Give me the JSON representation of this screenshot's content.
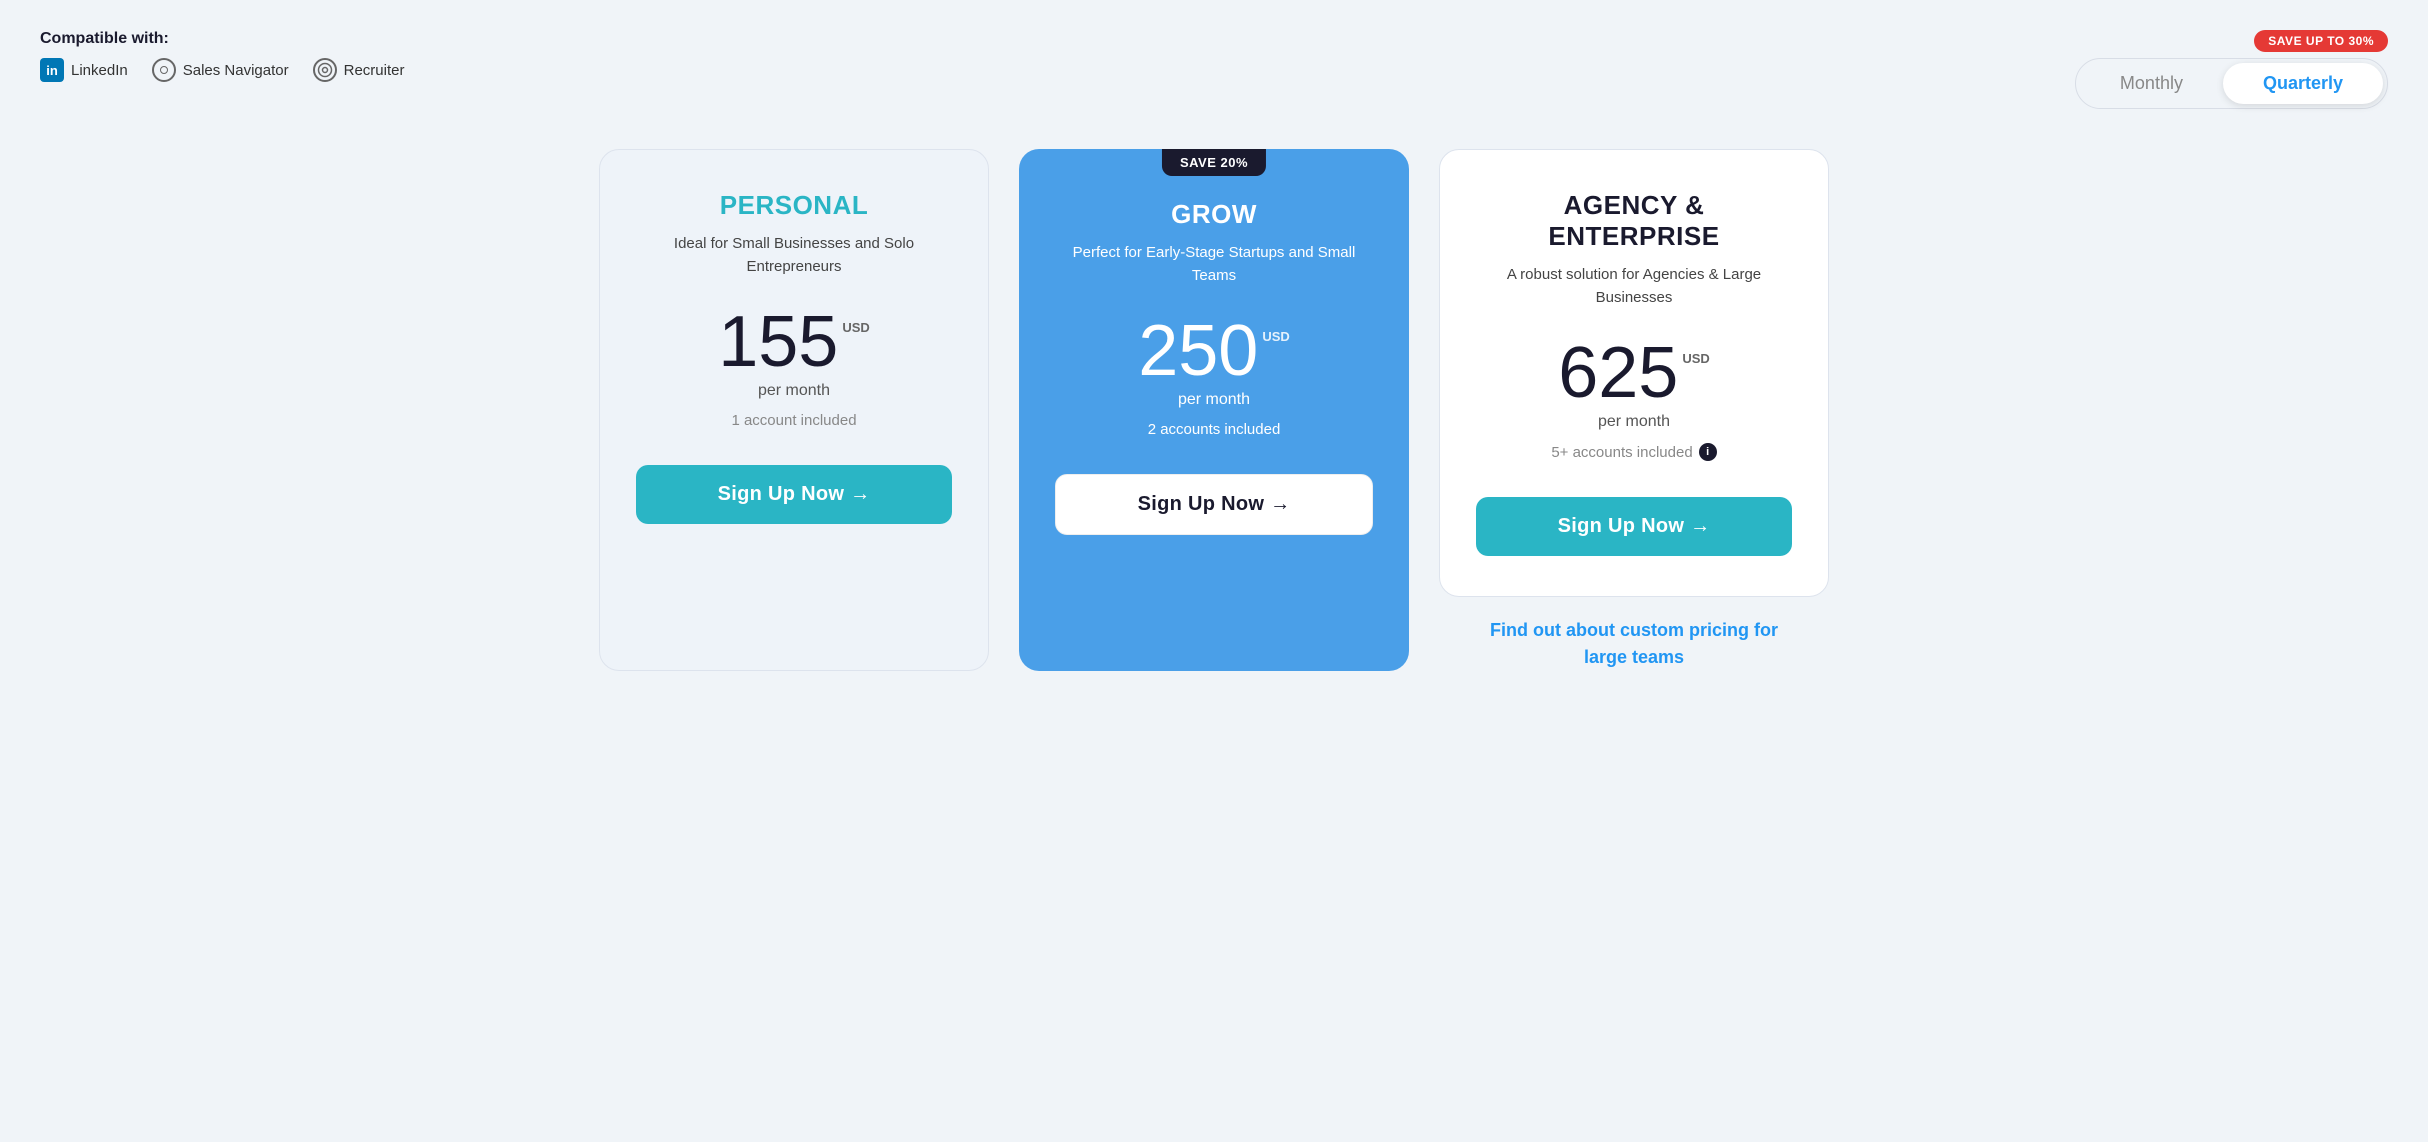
{
  "header": {
    "compatible_label": "Compatible with:",
    "integrations": [
      {
        "id": "linkedin",
        "name": "LinkedIn"
      },
      {
        "id": "sales-navigator",
        "name": "Sales Navigator"
      },
      {
        "id": "recruiter",
        "name": "Recruiter"
      }
    ],
    "save_badge": "SAVE UP TO 30%",
    "billing": {
      "monthly_label": "Monthly",
      "quarterly_label": "Quarterly",
      "active": "quarterly"
    }
  },
  "plans": [
    {
      "id": "personal",
      "name": "PERSONAL",
      "description": "Ideal for Small Businesses and Solo Entrepreneurs",
      "price": "155",
      "currency": "USD",
      "per_month": "per month",
      "accounts": "1 account included",
      "cta": "Sign Up Now →",
      "theme": "personal",
      "save_badge": null,
      "cta_theme": "teal"
    },
    {
      "id": "grow",
      "name": "GROW",
      "description": "Perfect for Early-Stage Startups and Small Teams",
      "price": "250",
      "currency": "USD",
      "per_month": "per month",
      "accounts": "2 accounts included",
      "cta": "Sign Up Now →",
      "theme": "grow",
      "save_badge": "SAVE 20%",
      "cta_theme": "white"
    },
    {
      "id": "enterprise",
      "name": "AGENCY & ENTERPRISE",
      "description": "A robust solution for Agencies & Large Businesses",
      "price": "625",
      "currency": "USD",
      "per_month": "per month",
      "accounts": "5+ accounts included",
      "has_info_icon": true,
      "cta": "Sign Up Now →",
      "theme": "enterprise",
      "save_badge": null,
      "cta_theme": "teal"
    }
  ],
  "custom_pricing": {
    "text": "Find out about custom pricing for large teams"
  }
}
